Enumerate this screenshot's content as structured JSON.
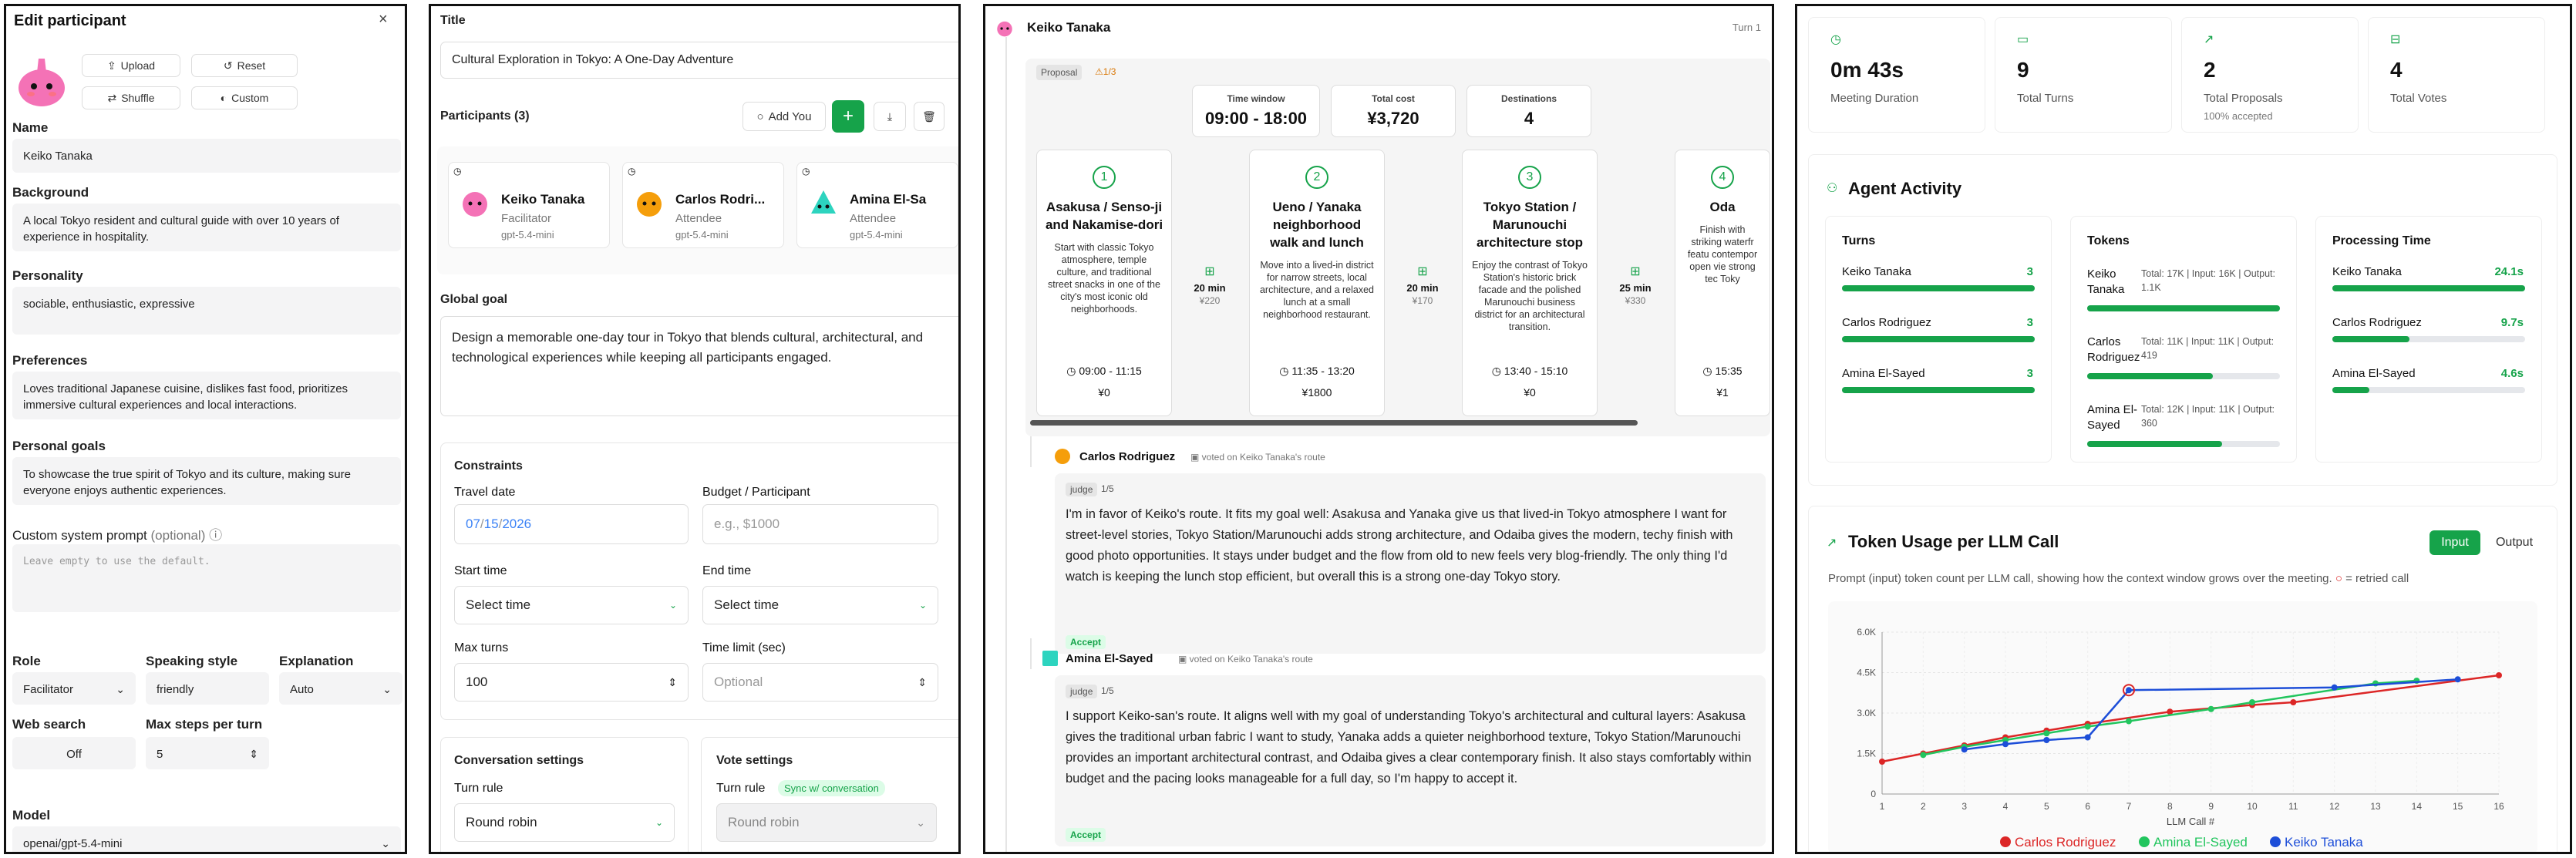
{
  "p1": {
    "title": "Edit participant",
    "upload": "Upload",
    "reset": "Reset",
    "shuffle": "Shuffle",
    "custom": "Custom",
    "name_label": "Name",
    "name": "Keiko Tanaka",
    "background_label": "Background",
    "background": "A local Tokyo resident and cultural guide with over 10 years of experience in hospitality.",
    "personality_label": "Personality",
    "personality": "sociable, enthusiastic, expressive",
    "preferences_label": "Preferences",
    "preferences": "Loves traditional Japanese cuisine, dislikes fast food, prioritizes immersive cultural experiences and local interactions.",
    "goals_label": "Personal goals",
    "goals": "To showcase the true spirit of Tokyo and its culture, making sure everyone enjoys authentic experiences.",
    "prompt_label": "Custom system prompt",
    "prompt_opt": "(optional)",
    "prompt_ph": "Leave empty to use the default.",
    "role_label": "Role",
    "role": "Facilitator",
    "style_label": "Speaking style",
    "style": "friendly",
    "expl_label": "Explanation",
    "expl": "Auto",
    "web_label": "Web search",
    "web": "Off",
    "steps_label": "Max steps per turn",
    "steps": "5",
    "model_label": "Model",
    "model": "openai/gpt-5.4-mini"
  },
  "p2": {
    "title_label": "Title",
    "title": "Cultural Exploration in Tokyo: A One-Day Adventure",
    "participants_label": "Participants (3)",
    "add_you": "Add You",
    "participants": [
      {
        "name": "Keiko Tanaka",
        "role": "Facilitator",
        "model": "gpt-5.4-mini"
      },
      {
        "name": "Carlos Rodri...",
        "role": "Attendee",
        "model": "gpt-5.4-mini"
      },
      {
        "name": "Amina El-Sa",
        "role": "Attendee",
        "model": "gpt-5.4-mini"
      }
    ],
    "goal_label": "Global goal",
    "goal": "Design a memorable one-day tour in Tokyo that blends cultural, architectural, and technological experiences while keeping all participants engaged.",
    "constraints": "Constraints",
    "date_label": "Travel date",
    "date_m": "07",
    "date_d": "15",
    "date_y": "2026",
    "budget_label": "Budget / Participant",
    "budget_ph": "e.g., $1000",
    "start_label": "Start time",
    "start": "Select time",
    "end_label": "End time",
    "end": "Select time",
    "turns_label": "Max turns",
    "turns": "100",
    "limit_label": "Time limit (sec)",
    "limit_ph": "Optional",
    "conv_title": "Conversation settings",
    "conv_rule_label": "Turn rule",
    "conv_rule": "Round robin",
    "vote_title": "Vote settings",
    "vote_rule_label": "Turn rule",
    "vote_sync": "Sync w/ conversation",
    "vote_rule": "Round robin"
  },
  "p3": {
    "speaker": "Keiko Tanaka",
    "turn": "Turn 1",
    "proposal": "Proposal",
    "proposal_count": "1/3",
    "stats": [
      {
        "label": "Time window",
        "value": "09:00 - 18:00"
      },
      {
        "label": "Total cost",
        "value": "¥3,720"
      },
      {
        "label": "Destinations",
        "value": "4"
      }
    ],
    "stops": [
      {
        "n": "1",
        "title": "Asakusa / Senso-ji and Nakamise-dori",
        "desc": "Start with classic Tokyo atmosphere, temple culture, and traditional street snacks in one of the city's most iconic old neighborhoods.",
        "time": "09:00 - 11:15",
        "cost": "¥0"
      },
      {
        "n": "2",
        "title": "Ueno / Yanaka neighborhood walk and lunch",
        "desc": "Move into a lived-in district for narrow streets, local architecture, and a relaxed lunch at a small neighborhood restaurant.",
        "time": "11:35 - 13:20",
        "cost": "¥1800"
      },
      {
        "n": "3",
        "title": "Tokyo Station / Marunouchi architecture stop",
        "desc": "Enjoy the contrast of Tokyo Station's historic brick facade and the polished Marunouchi business district for an architectural transition.",
        "time": "13:40 - 15:10",
        "cost": "¥0"
      },
      {
        "n": "4",
        "title": "Oda",
        "desc": "Finish with striking waterfr featu contempor open vie strong tec Toky",
        "time": "15:35",
        "cost": "¥1"
      }
    ],
    "legs": [
      {
        "dur": "20 min",
        "cost": "¥220"
      },
      {
        "dur": "20 min",
        "cost": "¥170"
      },
      {
        "dur": "25 min",
        "cost": "¥330"
      }
    ],
    "votes": [
      {
        "name": "Carlos Rodriguez",
        "tag": "voted on Keiko Tanaka's route",
        "judge": "judge",
        "score": "1/5",
        "text": "I'm in favor of Keiko's route. It fits my goal well: Asakusa and Yanaka give us that lived-in Tokyo atmosphere I want for street-level stories, Tokyo Station/Marunouchi adds strong architecture, and Odaiba gives the modern, techy finish with good photo opportunities. It stays under budget and the flow from old to new feels very blog-friendly. The only thing I'd watch is keeping the lunch stop efficient, but overall this is a strong one-day Tokyo story.",
        "verdict": "Accept"
      },
      {
        "name": "Amina El-Sayed",
        "tag": "voted on Keiko Tanaka's route",
        "judge": "judge",
        "score": "1/5",
        "text": "I support Keiko-san's route. It aligns well with my goal of understanding Tokyo's architectural and cultural layers: Asakusa gives the traditional urban fabric I want to study, Yanaka adds a quieter neighborhood texture, Tokyo Station/Marunouchi provides an important architectural contrast, and Odaiba gives a clear contemporary finish. It also stays comfortably within budget and the pacing looks manageable for a full day, so I'm happy to accept it.",
        "verdict": "Accept"
      }
    ]
  },
  "p4": {
    "stats": [
      {
        "value": "0m 43s",
        "label": "Meeting Duration",
        "sub": ""
      },
      {
        "value": "9",
        "label": "Total Turns",
        "sub": ""
      },
      {
        "value": "2",
        "label": "Total Proposals",
        "sub": "100% accepted"
      },
      {
        "value": "4",
        "label": "Total Votes",
        "sub": ""
      }
    ],
    "activity_title": "Agent Activity",
    "turns_title": "Turns",
    "turns": [
      {
        "name": "Keiko Tanaka",
        "value": "3",
        "frac": 1
      },
      {
        "name": "Carlos Rodriguez",
        "value": "3",
        "frac": 1
      },
      {
        "name": "Amina El-Sayed",
        "value": "3",
        "frac": 1
      }
    ],
    "tokens_title": "Tokens",
    "tokens": [
      {
        "name": "Keiko Tanaka",
        "detail": "Total: 17K | Input: 16K | Output: 1.1K",
        "frac": 1
      },
      {
        "name": "Carlos Rodriguez",
        "detail": "Total: 11K | Input: 11K | Output: 419",
        "frac": 0.65
      },
      {
        "name": "Amina El-Sayed",
        "detail": "Total: 12K | Input: 11K | Output: 360",
        "frac": 0.7
      }
    ],
    "time_title": "Processing Time",
    "times": [
      {
        "name": "Keiko Tanaka",
        "value": "24.1s",
        "frac": 1
      },
      {
        "name": "Carlos Rodriguez",
        "value": "9.7s",
        "frac": 0.4
      },
      {
        "name": "Amina El-Sayed",
        "value": "4.6s",
        "frac": 0.19
      }
    ],
    "usage_title": "Token Usage per LLM Call",
    "tab_input": "Input",
    "tab_output": "Output",
    "usage_desc": "Prompt (input) token count per LLM call, showing how the context window grows over the meeting.",
    "retried": "= retried call",
    "chart_data": {
      "type": "line",
      "x": [
        1,
        2,
        3,
        4,
        5,
        6,
        7,
        8,
        9,
        10,
        11,
        12,
        13,
        14,
        15,
        16
      ],
      "xlabel": "LLM Call #",
      "ylabel": "",
      "ylim": [
        0,
        6000
      ],
      "yticks": [
        "0",
        "1.5K",
        "3.0K",
        "4.5K",
        "6.0K"
      ],
      "series": [
        {
          "name": "Carlos Rodriguez",
          "color": "#dc2626",
          "points": [
            [
              1,
              1200
            ],
            [
              2,
              1500
            ],
            [
              3,
              1800
            ],
            [
              4,
              2100
            ],
            [
              5,
              2350
            ],
            [
              6,
              2600
            ],
            [
              8,
              3050
            ],
            [
              10,
              3300
            ],
            [
              11,
              3400
            ],
            [
              16,
              4400
            ]
          ]
        },
        {
          "name": "Amina El-Sayed",
          "color": "#22c55e",
          "points": [
            [
              2,
              1450
            ],
            [
              3,
              1750
            ],
            [
              4,
              2000
            ],
            [
              5,
              2250
            ],
            [
              6,
              2500
            ],
            [
              7,
              2700
            ],
            [
              9,
              3150
            ],
            [
              10,
              3400
            ],
            [
              13,
              4100
            ],
            [
              14,
              4200
            ]
          ]
        },
        {
          "name": "Keiko Tanaka",
          "color": "#1d4ed8",
          "points": [
            [
              3,
              1650
            ],
            [
              4,
              1850
            ],
            [
              5,
              2000
            ],
            [
              6,
              2100
            ],
            [
              7,
              3850
            ],
            [
              12,
              3950
            ],
            [
              15,
              4250
            ]
          ]
        }
      ],
      "retried": [
        [
          7,
          3850
        ]
      ]
    }
  }
}
